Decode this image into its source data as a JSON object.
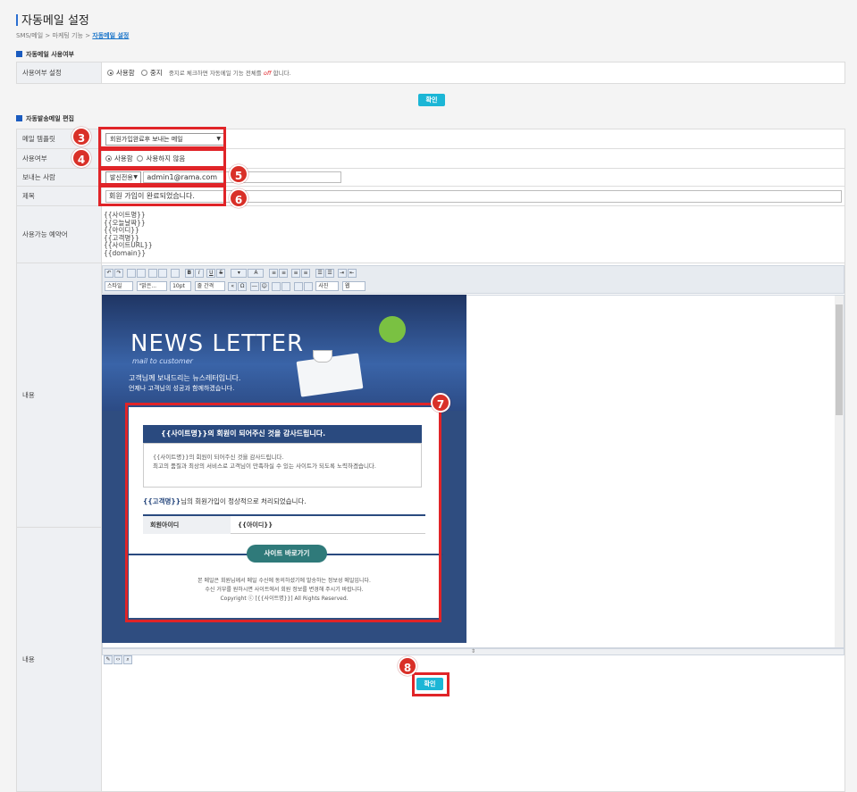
{
  "header": {
    "title": "자동메일 설정",
    "breadcrumb": [
      "SMS/메일",
      "마케팅 기능",
      "자동메일 설정"
    ],
    "separator": ">"
  },
  "usage_section": {
    "title": "자동메일 사용여부",
    "label": "사용여부 설정",
    "options": [
      "사용함",
      "중지"
    ],
    "selected": "사용함",
    "hint_prefix": "중지로 체크하면 자동메일 기능 전체를",
    "hint_off": "off",
    "hint_suffix": "합니다.",
    "confirm_label": "확인"
  },
  "edit_section": {
    "title": "자동발송메일 편집",
    "template_label": "메일 템플릿",
    "template_value": "회원가입완료후 보내는 메일",
    "use_label": "사용여부",
    "use_options": [
      "사용함",
      "사용하지 않음"
    ],
    "use_selected": "사용함",
    "sender_label": "보내는 사람",
    "sender_type": "발신전용",
    "sender_email": "admin1@rama.com",
    "subject_label": "제목",
    "subject_value": "회원 가입이 완료되었습니다.",
    "reserved_label": "사용가능 예약어",
    "reserved_words": [
      "{{사이트명}}",
      "{{오늘날짜}}",
      "{{아이디}}",
      "{{고객명}}",
      "{{사이트URL}}",
      "{{domain}}"
    ],
    "content_label": "내용",
    "content_label2": "내용",
    "confirm_label": "확인"
  },
  "toolbar": {
    "style": "스타일",
    "font": "\"맑은...",
    "size": "10pt",
    "spacing": "줄 간격",
    "photo": "사진",
    "web": "웹"
  },
  "newsletter": {
    "title": "NEWS LETTER",
    "subtitle": "mail to customer",
    "desc1": "고객님께 보내드리는 뉴스레터입니다.",
    "desc2": "언제나 고객님의 성공과 함께하겠습니다.",
    "bar_text": "{{사이트명}}의 회원이 되어주신 것을 감사드립니다.",
    "box_line1": "{{사이트명}}의 회원이 되어주신 것을 감사드립니다.",
    "box_line2": "최고의 품질과 최상의 서비스로 고객님이 만족하실 수 있는 사이트가 되도록 노력하겠습니다.",
    "line_name": "{{고객명}}",
    "line_suffix": "님의 회원가입이 정상적으로 처리되었습니다.",
    "id_label": "회원아이디",
    "id_value": "{{아이디}}",
    "button": "사이트 바로가기",
    "foot1": "본 메일은 회원님께서 메일 수신에 동의하셨기에 발송하는 정보성 메일입니다.",
    "foot2": "수신 거부를 원하시면 사이트에서 회원 정보를 변경해 주시기 바랍니다.",
    "foot3": "Copyright ⓒ [{{사이트명}}] All Rights Reserved."
  },
  "markers": [
    "3",
    "4",
    "5",
    "6",
    "7",
    "8"
  ],
  "colors": {
    "accent": "#1bb6d6",
    "highlight": "#e02428",
    "header_blue": "#2f4d80"
  }
}
